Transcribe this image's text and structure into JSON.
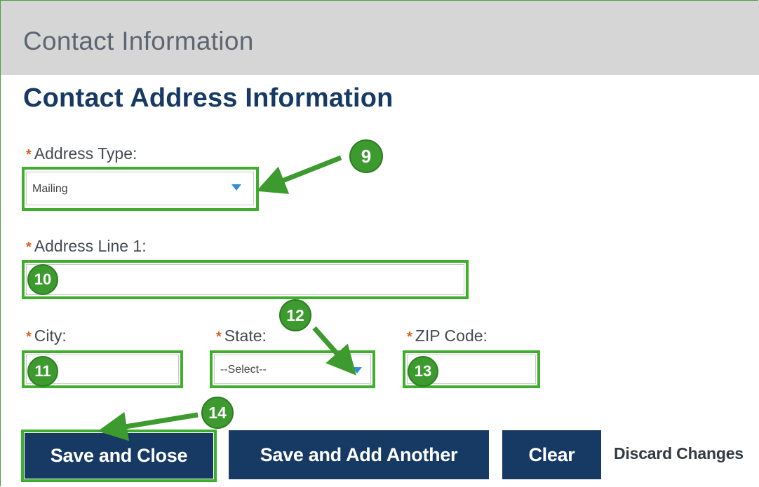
{
  "header": {
    "title": "Contact Information"
  },
  "section": {
    "title": "Contact Address Information"
  },
  "form": {
    "required_marker": "*",
    "address_type": {
      "label": "Address Type:",
      "value": "Mailing"
    },
    "address_line1": {
      "label": "Address Line 1:",
      "value": ""
    },
    "city": {
      "label": "City:",
      "value": ""
    },
    "state": {
      "label": "State:",
      "value": "--Select--"
    },
    "zip": {
      "label": "ZIP Code:",
      "value": ""
    }
  },
  "buttons": {
    "save_close": "Save and Close",
    "save_add": "Save and Add Another",
    "clear": "Clear",
    "discard": "Discard Changes"
  },
  "annotations": {
    "step_9": "9",
    "step_10": "10",
    "step_11": "11",
    "step_12": "12",
    "step_13": "13",
    "step_14": "14"
  },
  "colors": {
    "highlight": "#3fae2c",
    "badge": "#3c9a2e",
    "button": "#163a64",
    "title": "#163a64",
    "required": "#d9601e",
    "dropdown_caret": "#2f8fd6"
  }
}
